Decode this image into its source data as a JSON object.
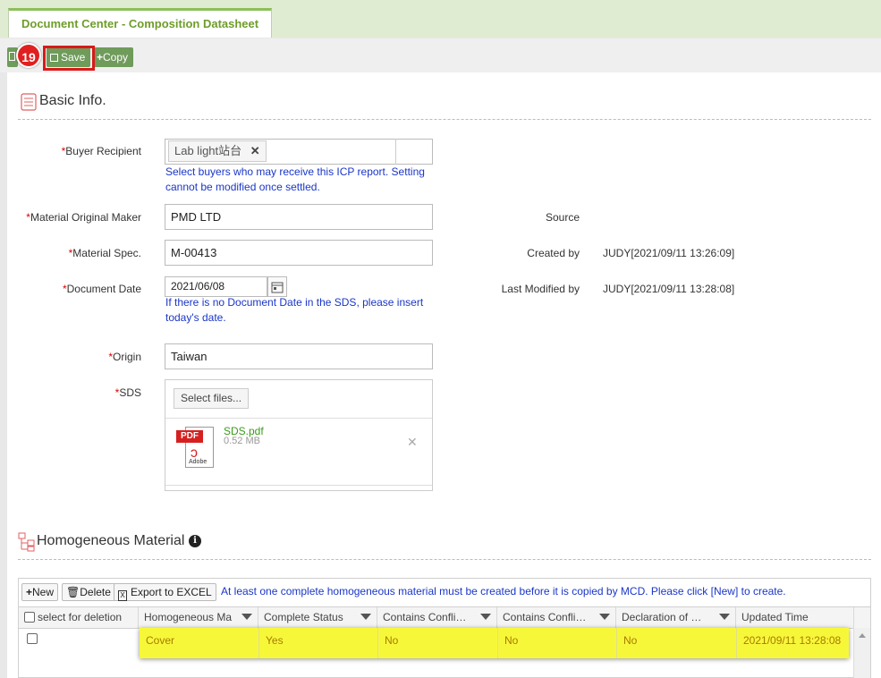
{
  "tab": {
    "title": "Document Center - Composition Datasheet"
  },
  "toolbar": {
    "step_number": "19",
    "save_label": "Save",
    "copy_label": "Copy"
  },
  "basic_info": {
    "title": "Basic Info.",
    "buyer_recipient": {
      "label": "Buyer Recipient",
      "chip": "Lab light站台",
      "hint_line1": "Select buyers who may receive this ICP report. Setting",
      "hint_line2": "cannot be modified once settled."
    },
    "material_original_maker": {
      "label": "Material Original Maker",
      "value": "PMD LTD"
    },
    "material_spec": {
      "label": "Material Spec.",
      "value": "M-00413"
    },
    "document_date": {
      "label": "Document Date",
      "value": "2021/06/08",
      "hint_line1": "If there is no Document Date in the SDS, please insert",
      "hint_line2": "today's date."
    },
    "origin": {
      "label": "Origin",
      "value": "Taiwan"
    },
    "sds": {
      "label": "SDS",
      "select_button": "Select files...",
      "file_name": "SDS.pdf",
      "file_size": "0.52 MB",
      "pdf_badge": "PDF",
      "adobe_text": "Adobe"
    },
    "required_mark": "*",
    "source": {
      "label": "Source",
      "value": ""
    },
    "created_by": {
      "label": "Created by",
      "value": "JUDY[2021/09/11 13:26:09]"
    },
    "last_modified_by": {
      "label": "Last Modified by",
      "value": "JUDY[2021/09/11 13:28:08]"
    }
  },
  "homogeneous": {
    "title": "Homogeneous Material",
    "new_label": "New",
    "delete_label": "Delete",
    "export_label": "Export to EXCEL",
    "note": "At least one complete homogeneous material must be created before it is copied by MCD. Please click [New] to create.",
    "columns": [
      "select for deletion",
      "Homogeneous Ma",
      "Complete Status",
      "Contains Confli…",
      "Contains Confli…",
      "Declaration of …",
      "Updated Time"
    ],
    "rows": [
      {
        "name": "Cover",
        "complete": "Yes",
        "conflict1": "No",
        "conflict2": "No",
        "declaration": "No",
        "updated": "2021/09/11 13:28:08"
      }
    ]
  },
  "colors": {
    "accent_green": "#6f9b5b",
    "tab_text": "#6e9d2a",
    "hint_blue": "#1a36c8",
    "highlight_yellow": "#f7f73a",
    "required_red": "#dd0000"
  }
}
